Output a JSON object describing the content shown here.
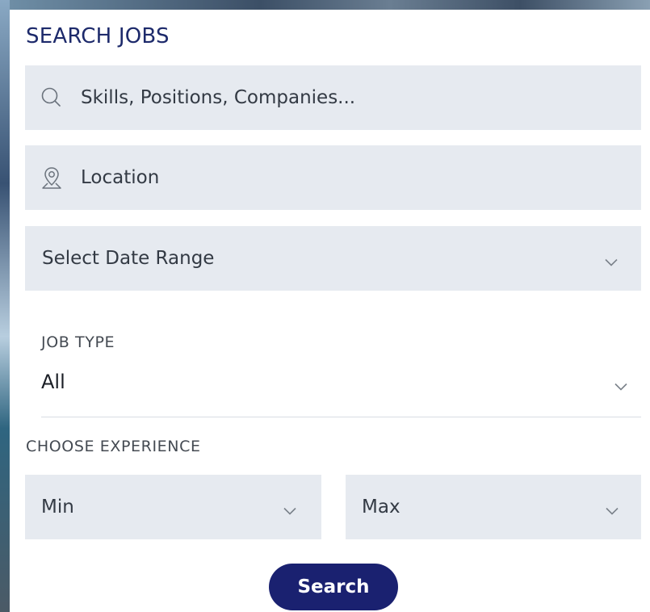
{
  "form": {
    "title": "SEARCH JOBS",
    "keywords": {
      "placeholder": "Skills, Positions, Companies...",
      "icon": "search-icon"
    },
    "location": {
      "placeholder": "Location",
      "icon": "location-pin-icon"
    },
    "date_range": {
      "placeholder": "Select Date Range",
      "icon": "chevron-down-icon"
    },
    "job_type": {
      "label": "JOB TYPE",
      "value": "All"
    },
    "experience": {
      "label": "CHOOSE EXPERIENCE",
      "min_placeholder": "Min",
      "max_placeholder": "Max"
    },
    "search_button": "Search"
  },
  "colors": {
    "title": "#1d2a6b",
    "field_bg": "#e6eaf0",
    "button_bg": "#1a2170",
    "button_text": "#ffffff"
  }
}
